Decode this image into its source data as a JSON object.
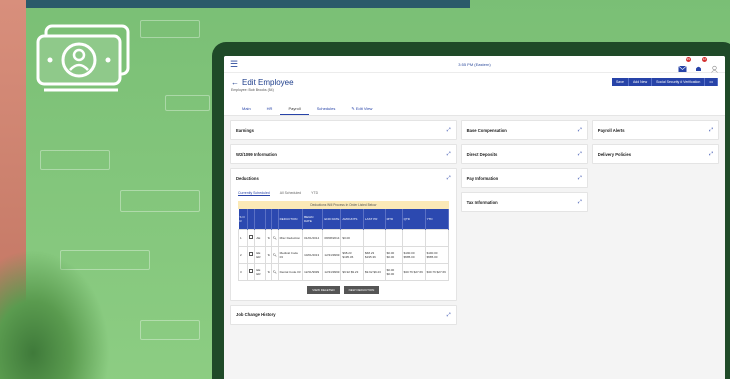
{
  "app": {
    "time": "3:55 PM (Eastern)",
    "notifications_count": "99",
    "alerts_count": "12"
  },
  "page": {
    "back_symbol": "←",
    "title": "Edit Employee",
    "subtitle": "Employee: Bob Brooks (54)",
    "actions": [
      "Save",
      "Add New",
      "Social Security # Verification",
      "•••"
    ],
    "tabs": [
      "Main",
      "HR",
      "Payroll",
      "Schedules",
      "Edit View"
    ],
    "active_tab": "Payroll"
  },
  "cards": {
    "earnings": "Earnings",
    "w2": "W2/1099 Information",
    "deductions": "Deductions",
    "job_change": "Job Change History",
    "base_comp": "Base Compensation",
    "direct_deposits": "Direct Deposits",
    "pay_info": "Pay Information",
    "tax_info": "Tax Information",
    "payroll_alerts": "Payroll Alerts",
    "delivery_policies": "Delivery Policies"
  },
  "deductions": {
    "subtabs": [
      "Currently Scheduled",
      "All Scheduled",
      "YTD"
    ],
    "banner": "Deductions Will Process In Order Listed Below",
    "columns": [
      "S O R",
      "",
      "",
      "",
      "",
      "DEDUCTION",
      "BEGIN DATE",
      "END DATE",
      "AMOUNTS",
      "LAST PR",
      "MTD",
      "QTD",
      "YTD"
    ],
    "rows": [
      {
        "n": "1",
        "code": "AE",
        "name": "Misc Deduction",
        "begin": "01/01/2014",
        "end": "08/08/2014",
        "amt": "$0.00",
        "last": "",
        "mtd": "",
        "qtd": "",
        "ytd": ""
      },
      {
        "n": "2",
        "code": "EE ER",
        "name": "Medical Code 03",
        "begin": "10/01/2013",
        "end": "12/31/9999",
        "amt": "$68.23 $195.36",
        "last": "$68.23 $195.36",
        "mtd": "$0.00 $0.00",
        "qtd": "$190.00 $585.00",
        "ytd": "$190.00 $585.00"
      },
      {
        "n": "3",
        "code": "EE ER",
        "name": "Dental Code 03",
        "begin": "12/31/9999",
        "end": "12/31/9999",
        "amt": "$9.92 $9.23",
        "last": "$9.92 $9.23",
        "mtd": "$0.00 $0.00",
        "qtd": "$30.76 $27.69",
        "ytd": "$30.76 $27.69"
      }
    ],
    "buttons": [
      "VIEW DELETED",
      "NEW DEDUCTION"
    ]
  }
}
